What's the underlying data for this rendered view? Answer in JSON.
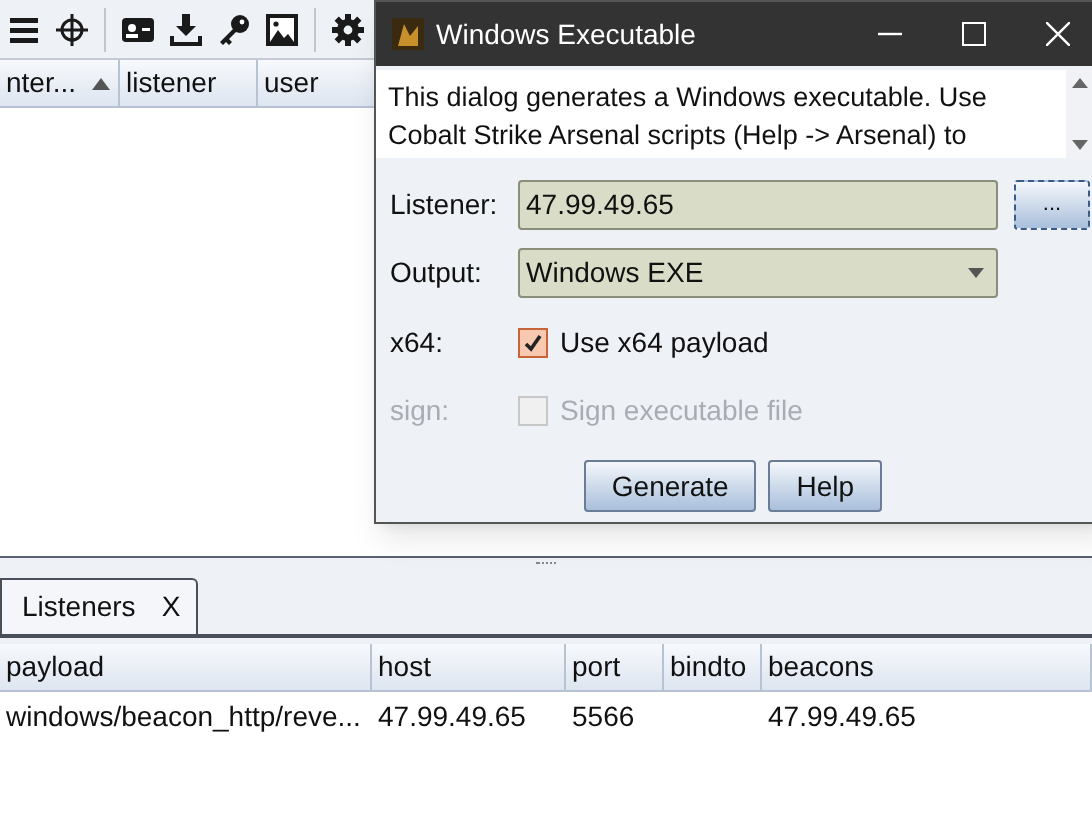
{
  "top_table": {
    "columns": [
      {
        "label": "nter...",
        "sorted": true
      },
      {
        "label": "listener",
        "sorted": false
      },
      {
        "label": "user",
        "sorted": false
      }
    ]
  },
  "dialog": {
    "title": "Windows Executable",
    "description": "This dialog generates a Windows executable. Use Cobalt Strike Arsenal scripts (Help -> Arsenal) to",
    "listener": {
      "label": "Listener:",
      "value": "47.99.49.65",
      "browse": "..."
    },
    "output": {
      "label": "Output:",
      "value": "Windows EXE"
    },
    "options": [
      {
        "label": "x64:",
        "text": "Use x64 payload",
        "checked": true,
        "disabled": false
      },
      {
        "label": "sign:",
        "text": "Sign executable file",
        "checked": false,
        "disabled": true
      }
    ],
    "buttons": [
      "Generate",
      "Help"
    ]
  },
  "tabs": [
    {
      "label": "Listeners",
      "close": "X",
      "selected": true
    }
  ],
  "listeners_table": {
    "columns": [
      "payload",
      "host",
      "port",
      "bindto",
      "beacons"
    ],
    "rows": [
      [
        "windows/beacon_http/reve...",
        "47.99.49.65",
        "5566",
        "",
        "47.99.49.65"
      ]
    ]
  }
}
